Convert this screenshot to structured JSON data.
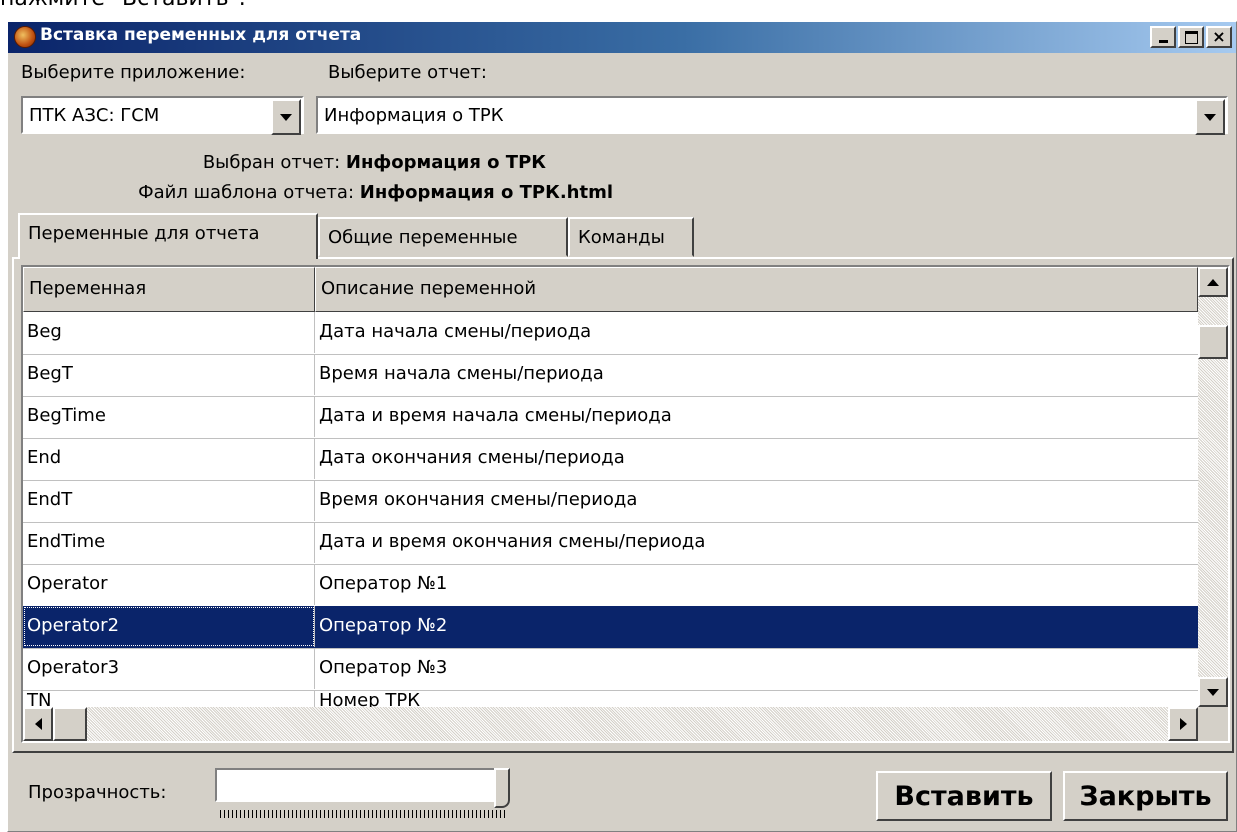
{
  "top_caption": "нажмите \"Вставить\".",
  "window": {
    "title": "Вставка переменных для отчета",
    "minimize_glyph": "_",
    "maximize_glyph": "□",
    "close_glyph": "×"
  },
  "app_select": {
    "label": "Выберите приложение:",
    "value": "ПТК АЗС: ГСМ"
  },
  "report_select": {
    "label": "Выберите отчет:",
    "value": "Информация о ТРК"
  },
  "info": {
    "selected_label": "Выбран отчет:",
    "selected_value": "Информация о ТРК",
    "template_label": "Файл шаблона отчета:",
    "template_value": "Информация о ТРК.html"
  },
  "tabs": [
    {
      "label": "Переменные для отчета",
      "active": true
    },
    {
      "label": "Общие переменные",
      "active": false
    },
    {
      "label": "Команды",
      "active": false
    }
  ],
  "grid": {
    "columns": [
      "Переменная",
      "Описание переменной"
    ],
    "rows": [
      {
        "name": "Beg",
        "desc": "Дата начала смены/периода"
      },
      {
        "name": "BegT",
        "desc": "Время начала смены/периода"
      },
      {
        "name": "BegTime",
        "desc": "Дата и время начала смены/периода"
      },
      {
        "name": "End",
        "desc": "Дата окончания смены/периода"
      },
      {
        "name": "EndT",
        "desc": "Время окончания смены/периода"
      },
      {
        "name": "EndTime",
        "desc": "Дата и время окончания смены/периода"
      },
      {
        "name": "Operator",
        "desc": "Оператор №1"
      },
      {
        "name": "Operator2",
        "desc": "Оператор №2"
      },
      {
        "name": "Operator3",
        "desc": "Оператор №3"
      },
      {
        "name": "TN",
        "desc": "Номер ТРК"
      }
    ],
    "selected_index": 7
  },
  "transparency": {
    "label": "Прозрачность:",
    "level": 1.0
  },
  "buttons": {
    "insert": "Вставить",
    "close": "Закрыть"
  },
  "colors": {
    "selection": "#0a246a",
    "window_face": "#d4d0c8",
    "title_gradient_start": "#0a246a",
    "title_gradient_end": "#a6caf0"
  }
}
